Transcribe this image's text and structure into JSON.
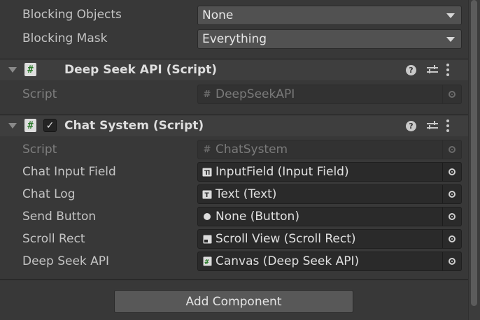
{
  "rows_top": [
    {
      "label": "Blocking Objects",
      "value": "None"
    },
    {
      "label": "Blocking Mask",
      "value": "Everything"
    }
  ],
  "deepseek": {
    "title": "Deep Seek API (Script)",
    "script_label": "Script",
    "script_value": "DeepSeekAPI"
  },
  "chat": {
    "title": "Chat System (Script)",
    "script_label": "Script",
    "script_value": "ChatSystem",
    "fields": [
      {
        "label": "Chat Input Field",
        "value": "InputField (Input Field)",
        "icon": "input-field-icon"
      },
      {
        "label": "Chat Log",
        "value": "Text (Text)",
        "icon": "text-icon"
      },
      {
        "label": "Send Button",
        "value": "None (Button)",
        "icon": "button-icon"
      },
      {
        "label": "Scroll Rect",
        "value": "Scroll View (Scroll Rect)",
        "icon": "scroll-rect-icon"
      },
      {
        "label": "Deep Seek API",
        "value": "Canvas (Deep Seek API)",
        "icon": "script-icon"
      }
    ]
  },
  "icons": {
    "script_glyph": "#",
    "check_glyph": "✓",
    "help_glyph": "?"
  },
  "add_component_label": "Add Component",
  "colors": {
    "background": "#383838",
    "field": "#2a2a2a",
    "dropdown": "#515151",
    "script_green": "#2c7a2c"
  }
}
